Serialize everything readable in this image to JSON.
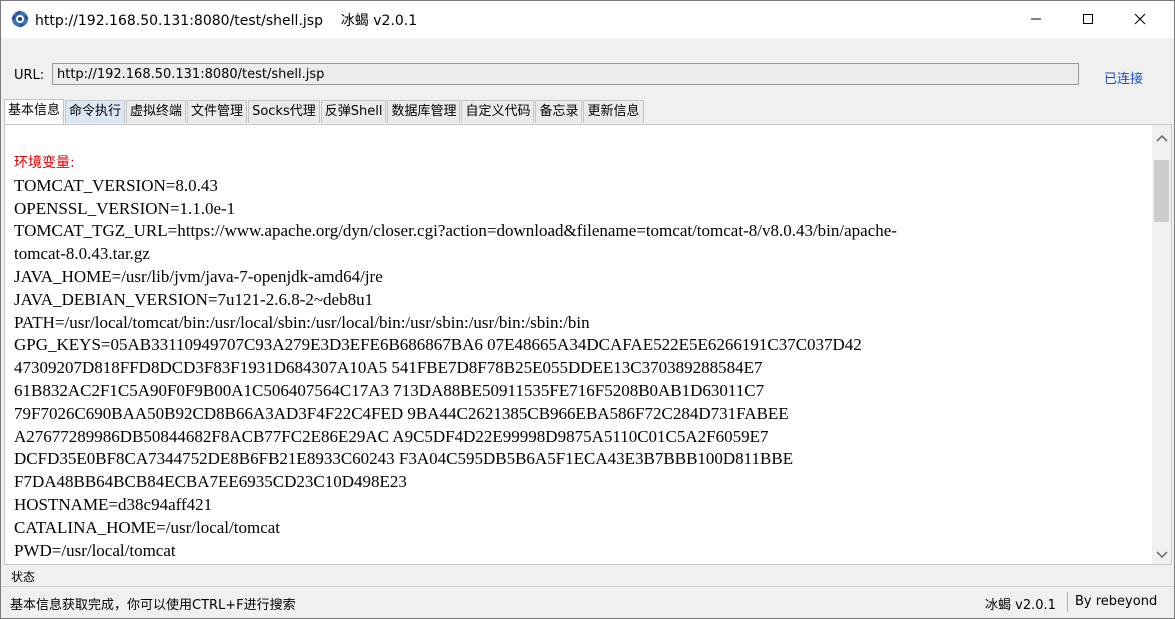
{
  "window": {
    "title": "http://192.168.50.131:8080/test/shell.jsp    冰蝎 v2.0.1",
    "app_icon": "behinder-logo-icon",
    "controls": {
      "minimize": "minimize-icon",
      "maximize": "maximize-icon",
      "close": "close-icon"
    }
  },
  "url_bar": {
    "label": "URL:",
    "value": "http://192.168.50.131:8080/test/shell.jsp",
    "connection_status": "已连接",
    "status_color": "#1a50c8"
  },
  "tabs": [
    {
      "label": "基本信息",
      "active": true
    },
    {
      "label": "命令执行",
      "active": false
    },
    {
      "label": "虚拟终端",
      "active": false
    },
    {
      "label": "文件管理",
      "active": false
    },
    {
      "label": "Socks代理",
      "active": false
    },
    {
      "label": "反弹Shell",
      "active": false
    },
    {
      "label": "数据库管理",
      "active": false
    },
    {
      "label": "自定义代码",
      "active": false
    },
    {
      "label": "备忘录",
      "active": false
    },
    {
      "label": "更新信息",
      "active": false
    }
  ],
  "content": {
    "heading": "环境变量:",
    "heading_color": "#e00000",
    "lines": [
      "TOMCAT_VERSION=8.0.43",
      "OPENSSL_VERSION=1.1.0e-1",
      "TOMCAT_TGZ_URL=https://www.apache.org/dyn/closer.cgi?action=download&filename=tomcat/tomcat-8/v8.0.43/bin/apache-",
      "tomcat-8.0.43.tar.gz",
      "JAVA_HOME=/usr/lib/jvm/java-7-openjdk-amd64/jre",
      "JAVA_DEBIAN_VERSION=7u121-2.6.8-2~deb8u1",
      "PATH=/usr/local/tomcat/bin:/usr/local/sbin:/usr/local/bin:/usr/sbin:/usr/bin:/sbin:/bin",
      "GPG_KEYS=05AB33110949707C93A279E3D3EFE6B686867BA6 07E48665A34DCAFAE522E5E6266191C37C037D42",
      "47309207D818FFD8DCD3F83F1931D684307A10A5 541FBE7D8F78B25E055DDEE13C370389288584E7",
      "61B832AC2F1C5A90F0F9B00A1C506407564C17A3 713DA88BE50911535FE716F5208B0AB1D63011C7",
      "79F7026C690BAA50B92CD8B66A3AD3F4F22C4FED 9BA44C2621385CB966EBA586F72C284D731FABEE",
      "A27677289986DB50844682F8ACB77FC2E86E29AC A9C5DF4D22E99998D9875A5110C01C5A2F6059E7",
      "DCFD35E0BF8CA7344752DE8B6FB21E8933C60243 F3A04C595DB5B6A5F1ECA43E3B7BBB100D811BBE",
      "F7DA48BB64BCB84ECBA7EE6935CD23C10D498E23",
      "HOSTNAME=d38c94aff421",
      "CATALINA_HOME=/usr/local/tomcat",
      "PWD=/usr/local/tomcat"
    ]
  },
  "status_panel": {
    "label": "状态",
    "message": "基本信息获取完成，你可以使用CTRL+F进行搜索",
    "version": "冰蝎 v2.0.1",
    "author": "By rebeyond"
  }
}
